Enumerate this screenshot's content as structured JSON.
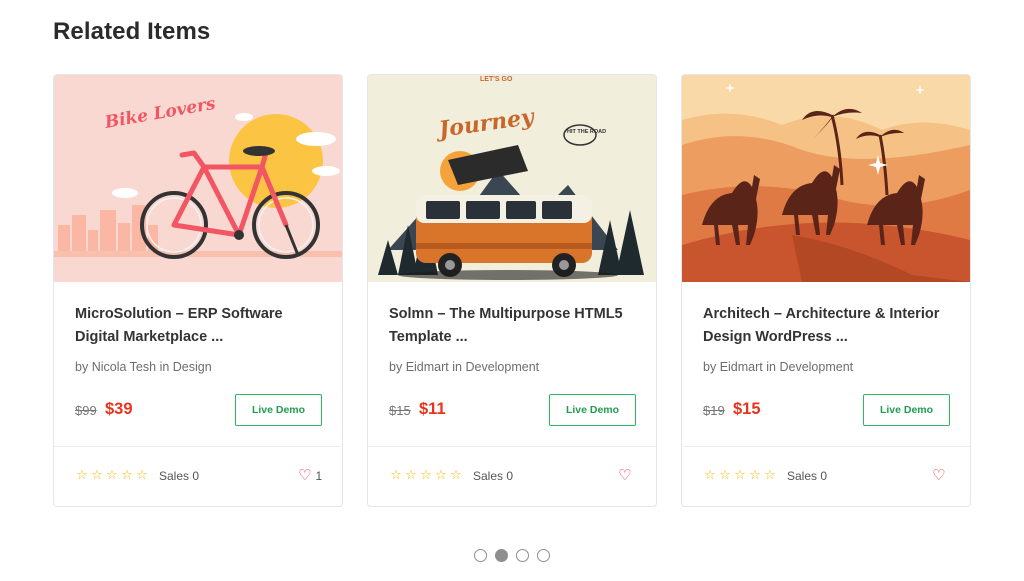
{
  "section": {
    "title": "Related Items"
  },
  "items": [
    {
      "title": "MicroSolution – ERP Software Digital Marketplace ...",
      "by_prefix": "by",
      "author": "Nicola Tesh",
      "in_word": "in",
      "category": "Design",
      "old_price": "$99",
      "new_price": "$39",
      "demo_label": "Live Demo",
      "sales_label": "Sales 0",
      "favorites": "1",
      "thumb_text": "Bike Lovers",
      "thumb_colors": {
        "bg": "#fad8d2",
        "accent": "#f25663",
        "sun": "#fbc443"
      }
    },
    {
      "title": "Solmn – The Multipurpose HTML5 Template ...",
      "by_prefix": "by",
      "author": "Eidmart",
      "in_word": "in",
      "category": "Development",
      "old_price": "$15",
      "new_price": "$11",
      "demo_label": "Live Demo",
      "sales_label": "Sales 0",
      "favorites": "",
      "thumb_text": "Journey",
      "thumb_text_small": "LET'S GO",
      "thumb_badge": "HIT THE ROAD",
      "thumb_colors": {
        "bg": "#f1eedb",
        "van": "#d9742b",
        "script": "#c9662b"
      }
    },
    {
      "title": "Architech – Architecture & Interior Design WordPress ...",
      "by_prefix": "by",
      "author": "Eidmart",
      "in_word": "in",
      "category": "Development",
      "old_price": "$19",
      "new_price": "$15",
      "demo_label": "Live Demo",
      "sales_label": "Sales 0",
      "favorites": "",
      "thumb_colors": {
        "sky": "#f2b16f",
        "dune": "#c9552e",
        "silhouette": "#5a2418"
      }
    }
  ],
  "star_glyph": "☆",
  "heart_icon": "heart-outline",
  "pagination": {
    "count": 4,
    "active_index": 1
  },
  "colors": {
    "price_new": "#e8341c",
    "demo_border": "#2db864",
    "star": "#f5b400",
    "heart": "#e0342d"
  }
}
